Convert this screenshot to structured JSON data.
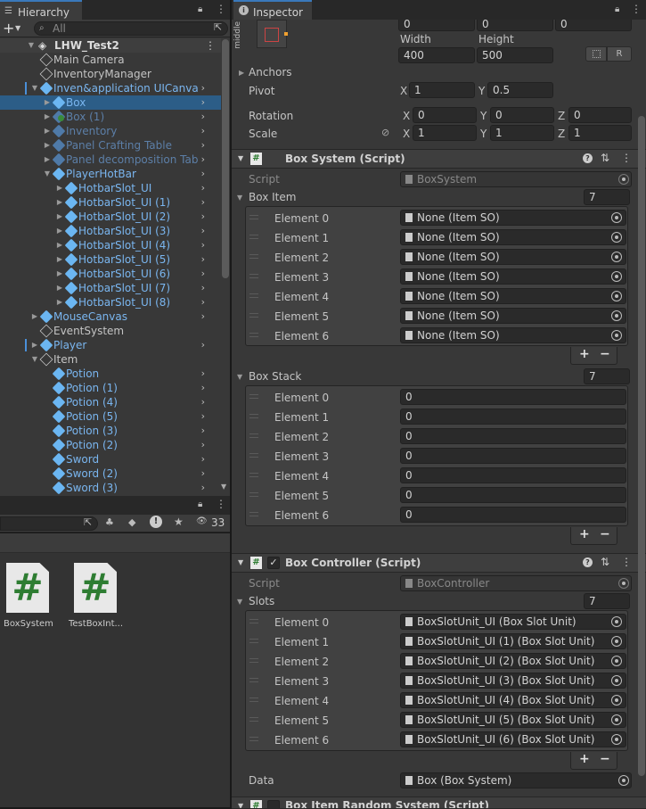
{
  "hierarchy": {
    "tab_title": "Hierarchy",
    "search_placeholder": "All",
    "add_label": "+",
    "root": "LHW_Test2",
    "items": [
      "Main Camera",
      "InventoryManager",
      "Inven&application UICanva",
      "Box",
      "Box (1)",
      "Inventory",
      "Panel Crafting Table",
      "Panel decomposition Tab",
      "PlayerHotBar",
      "HotbarSlot_UI",
      "HotbarSlot_UI (1)",
      "HotbarSlot_UI (2)",
      "HotbarSlot_UI (3)",
      "HotbarSlot_UI (4)",
      "HotbarSlot_UI (5)",
      "HotbarSlot_UI (6)",
      "HotbarSlot_UI (7)",
      "HotbarSlot_UI (8)",
      "MouseCanvas",
      "EventSystem",
      "Player",
      "Item",
      "Potion",
      "Potion (1)",
      "Potion (4)",
      "Potion (5)",
      "Potion (3)",
      "Potion (2)",
      "Sword",
      "Sword (2)",
      "Sword (3)"
    ]
  },
  "project": {
    "hidden_count": "33",
    "files": [
      {
        "name": "BoxSystem",
        "icon": "#"
      },
      {
        "name": "TestBoxInt...",
        "icon": "#"
      }
    ]
  },
  "inspector": {
    "tab_title": "Inspector",
    "rect": {
      "middle_label": "middle",
      "top_values": [
        "0",
        "0",
        "0"
      ],
      "width_label": "Width",
      "height_label": "Height",
      "width": "400",
      "height": "500",
      "r_label": "R"
    },
    "anchors_label": "Anchors",
    "pivot": {
      "label": "Pivot",
      "x": "1",
      "y": "0.5"
    },
    "rotation": {
      "label": "Rotation",
      "x": "0",
      "y": "0",
      "z": "0"
    },
    "scale": {
      "label": "Scale",
      "x": "1",
      "y": "1",
      "z": "1"
    },
    "axis": {
      "x": "X",
      "y": "Y",
      "z": "Z"
    },
    "box_system": {
      "title": "Box System (Script)",
      "script_label": "Script",
      "script_value": "BoxSystem",
      "box_item_label": "Box Item",
      "box_item_count": "7",
      "box_item_elements": [
        "Element 0",
        "Element 1",
        "Element 2",
        "Element 3",
        "Element 4",
        "Element 5",
        "Element 6"
      ],
      "box_item_values": [
        "None (Item SO)",
        "None (Item SO)",
        "None (Item SO)",
        "None (Item SO)",
        "None (Item SO)",
        "None (Item SO)",
        "None (Item SO)"
      ],
      "box_stack_label": "Box Stack",
      "box_stack_count": "7",
      "box_stack_elements": [
        "Element 0",
        "Element 1",
        "Element 2",
        "Element 3",
        "Element 4",
        "Element 5",
        "Element 6"
      ],
      "box_stack_values": [
        "0",
        "0",
        "0",
        "0",
        "0",
        "0",
        "0"
      ]
    },
    "box_controller": {
      "title": "Box Controller (Script)",
      "script_label": "Script",
      "script_value": "BoxController",
      "slots_label": "Slots",
      "slots_count": "7",
      "slot_elements": [
        "Element 0",
        "Element 1",
        "Element 2",
        "Element 3",
        "Element 4",
        "Element 5",
        "Element 6"
      ],
      "slot_values": [
        "BoxSlotUnit_UI (Box Slot Unit)",
        "BoxSlotUnit_UI (1) (Box Slot Unit)",
        "BoxSlotUnit_UI (2) (Box Slot Unit)",
        "BoxSlotUnit_UI (3) (Box Slot Unit)",
        "BoxSlotUnit_UI (4) (Box Slot Unit)",
        "BoxSlotUnit_UI (5) (Box Slot Unit)",
        "BoxSlotUnit_UI (6) (Box Slot Unit)"
      ],
      "data_label": "Data",
      "data_value": "Box (Box System)"
    },
    "box_item_random": {
      "title": "Box Item Random System (Script)"
    }
  }
}
